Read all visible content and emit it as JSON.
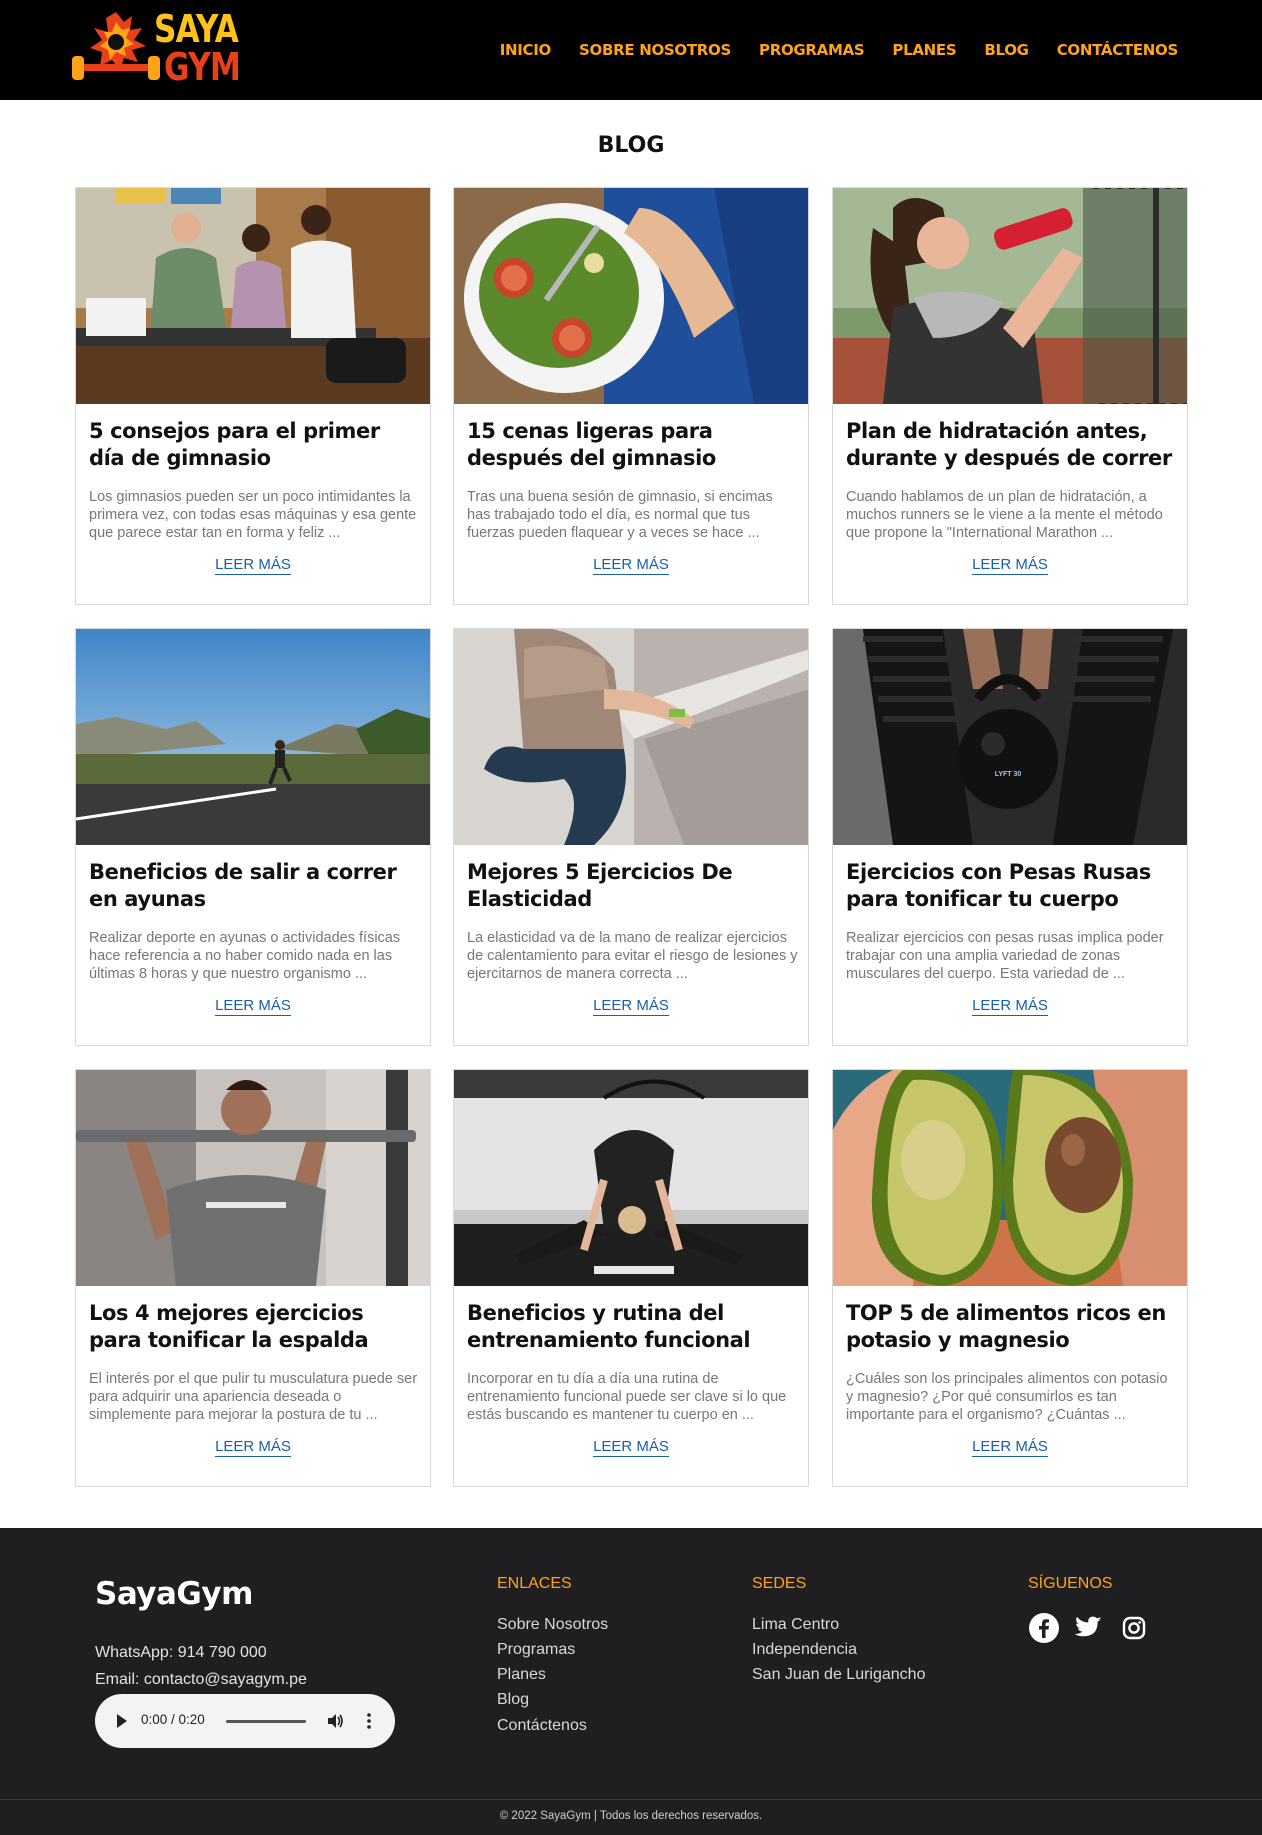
{
  "header": {
    "logo_line1": "SAYA",
    "logo_line2": "GYM",
    "nav": [
      "INICIO",
      "SOBRE NOSOTROS",
      "PROGRAMAS",
      "PLANES",
      "BLOG",
      "CONTÁCTENOS"
    ],
    "accent_color": "#ffa319"
  },
  "page": {
    "title": "BLOG"
  },
  "posts": [
    {
      "title": "5 consejos para el primer día de gimnasio",
      "excerpt": "Los gimnasios pueden ser un poco intimidantes la primera vez, con todas esas máquinas y esa gente que parece estar tan en forma y feliz ...",
      "link": "LEER MÁS",
      "image": "gym-reception-photo"
    },
    {
      "title": "15 cenas ligeras para después del gimnasio",
      "excerpt": "Tras una buena sesión de gimnasio, si encimas has trabajado todo el día, es normal que tus fuerzas pueden flaquear y a veces se hace ...",
      "link": "LEER MÁS",
      "image": "salad-plate-photo"
    },
    {
      "title": "Plan de hidratación antes, durante y después de correr",
      "excerpt": "Cuando hablamos de un plan de hidratación, a muchos runners se le viene a la mente el método que propone la \"International Marathon ...",
      "link": "LEER MÁS",
      "image": "woman-drinking-photo"
    },
    {
      "title": "Beneficios de salir a correr en ayunas",
      "excerpt": "Realizar deporte en ayunas o actividades físicas hace referencia a no haber comido nada en las últimas 8 horas y que nuestro organismo ...",
      "link": "LEER MÁS",
      "image": "road-runner-photo"
    },
    {
      "title": "Mejores 5 Ejercicios De Elasticidad",
      "excerpt": "La elasticidad va de la mano de realizar ejercicios de calentamiento para evitar el riesgo de lesiones y ejercitarnos de manera correcta ...",
      "link": "LEER MÁS",
      "image": "stretching-photo"
    },
    {
      "title": "Ejercicios con Pesas Rusas para tonificar tu cuerpo",
      "excerpt": "Realizar ejercicios con pesas rusas implica poder trabajar con una amplia variedad de zonas musculares del cuerpo. Esta variedad de ...",
      "link": "LEER MÁS",
      "image": "kettlebell-photo",
      "kettlebell_label": "LYFT 30"
    },
    {
      "title": "Los 4 mejores ejercicios para tonificar la espalda",
      "excerpt": "El interés por el que pulir tu musculatura puede ser para adquirir una apariencia deseada o simplemente para mejorar la postura de tu ...",
      "link": "LEER MÁS",
      "image": "pullup-photo"
    },
    {
      "title": "Beneficios y rutina del entrenamiento funcional",
      "excerpt": "Incorporar en tu día a día una rutina de entrenamiento funcional puede ser clave si lo que estás buscando es mantener tu cuerpo en ...",
      "link": "LEER MÁS",
      "image": "functional-training-photo"
    },
    {
      "title": "TOP 5 de alimentos ricos en potasio y magnesio",
      "excerpt": "¿Cuáles son los principales alimentos con potasio y magnesio? ¿Por qué consumirlos es tan importante para el organismo? ¿Cuántas ...",
      "link": "LEER MÁS",
      "image": "avocado-photo"
    }
  ],
  "footer": {
    "brand": "SayaGym",
    "whatsapp": "WhatsApp: 914 790 000",
    "email": "Email: contacto@sayagym.pe",
    "audio_time": "0:00 / 0:20",
    "links_heading": "ENLACES",
    "links": [
      "Sobre Nosotros",
      "Programas",
      "Planes",
      "Blog",
      "Contáctenos"
    ],
    "sedes_heading": "SEDES",
    "sedes": [
      "Lima Centro",
      "Independencia",
      "San Juan de Lurigancho"
    ],
    "social_heading": "SÍGUENOS",
    "social_icons": [
      "facebook-icon",
      "twitter-icon",
      "instagram-icon"
    ],
    "copyright": "© 2022 SayaGym | Todos los derechos reservados."
  }
}
